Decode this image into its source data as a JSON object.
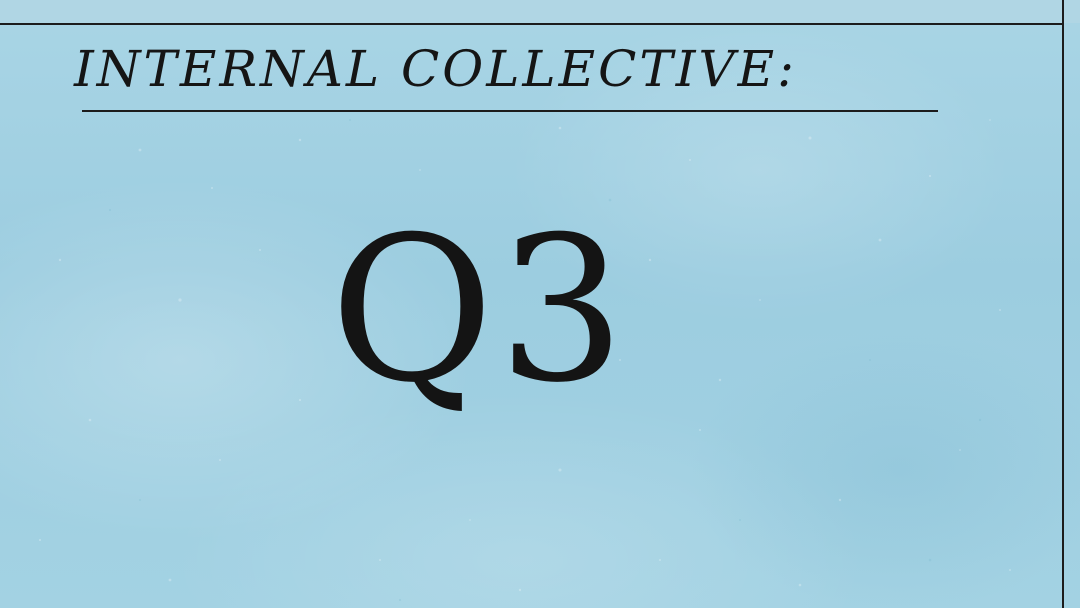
{
  "poster": {
    "title": "INTERNAL COLLECTIVE:",
    "quarter": "Q3"
  },
  "colors": {
    "background": "#9fcfe0",
    "ink": "#151515"
  }
}
